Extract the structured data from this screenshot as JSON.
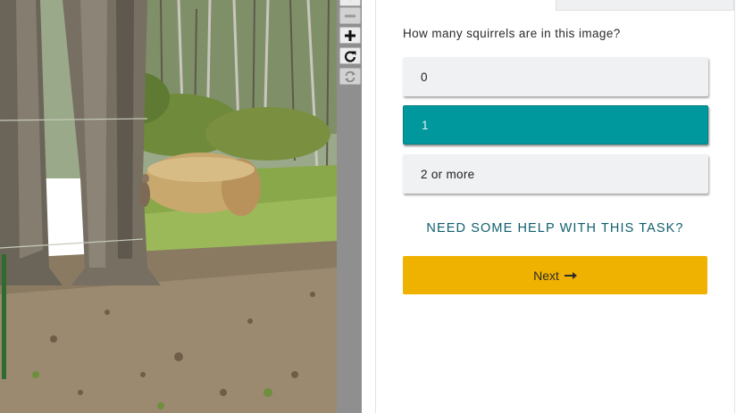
{
  "subject_image": {
    "alt": ""
  },
  "toolbar": {
    "buttons": [
      {
        "icon": "chevron-down-icon"
      },
      {
        "icon": "zoom-out-icon"
      },
      {
        "icon": "zoom-in-icon"
      },
      {
        "icon": "rotate-icon"
      },
      {
        "icon": "reset-icon"
      }
    ]
  },
  "task": {
    "question": "How many squirrels are in this image?",
    "answers": [
      {
        "label": "0",
        "selected": false
      },
      {
        "label": "1",
        "selected": true
      },
      {
        "label": "2 or more",
        "selected": false
      }
    ],
    "help_link": "NEED SOME HELP WITH THIS TASK?",
    "next_label": "Next"
  },
  "colors": {
    "selected_answer": "#00979d",
    "next_button": "#f0b200",
    "help_link": "#0f5e6d",
    "toolbar": "#8f8f8f"
  }
}
